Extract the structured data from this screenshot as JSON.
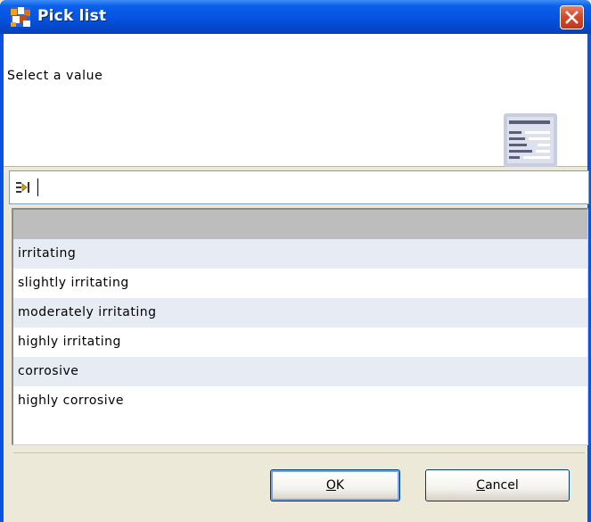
{
  "window": {
    "title": "Pick list"
  },
  "header": {
    "prompt": "Select a value"
  },
  "filter": {
    "value": "",
    "placeholder": ""
  },
  "list": {
    "items": [
      "",
      "irritating",
      "slightly irritating",
      "moderately irritating",
      "highly irritating",
      "corrosive",
      "highly corrosive"
    ],
    "selected_index": 0
  },
  "buttons": {
    "ok_mnemonic": "O",
    "ok_rest": "K",
    "cancel_mnemonic": "C",
    "cancel_rest": "ancel"
  },
  "icons": {
    "app": "app-logo-icon",
    "close": "close-icon",
    "header": "list-document-icon",
    "filter": "filter-arrow-icon"
  },
  "colors": {
    "titlebar": "#0553e0",
    "selected_row": "#bdbdbd",
    "alt_row": "#e7ebf3",
    "close_button": "#d5492c"
  }
}
